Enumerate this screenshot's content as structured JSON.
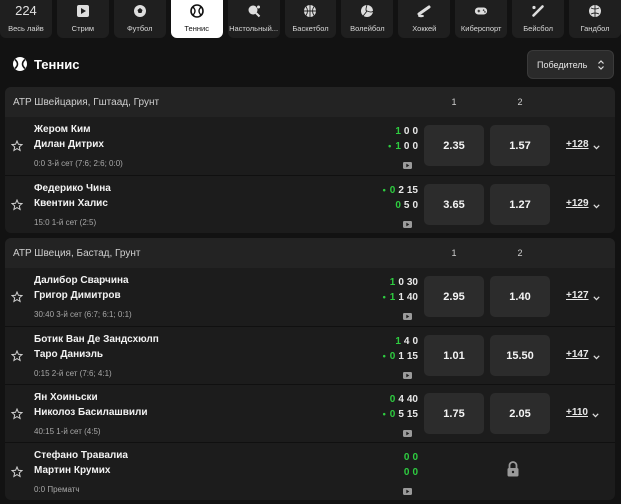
{
  "sports_bar": [
    {
      "label": "Весь лайв",
      "count": "224",
      "icon": "live-count",
      "active": false
    },
    {
      "label": "Стрим",
      "icon": "play-icon",
      "active": false
    },
    {
      "label": "Футбол",
      "icon": "soccer-ball-icon",
      "active": false
    },
    {
      "label": "Теннис",
      "icon": "tennis-ball-icon",
      "active": true
    },
    {
      "label": "Настольный...",
      "icon": "table-tennis-icon",
      "active": false
    },
    {
      "label": "Баскетбол",
      "icon": "basketball-icon",
      "active": false
    },
    {
      "label": "Волейбол",
      "icon": "volleyball-icon",
      "active": false
    },
    {
      "label": "Хоккей",
      "icon": "hockey-puck-icon",
      "active": false
    },
    {
      "label": "Киберспорт",
      "icon": "gamepad-icon",
      "active": false
    },
    {
      "label": "Бейсбол",
      "icon": "baseball-bat-icon",
      "active": false
    },
    {
      "label": "Гандбол",
      "icon": "handball-icon",
      "active": false
    }
  ],
  "page": {
    "title": "Теннис",
    "sort_label": "Победитель"
  },
  "colors": {
    "background": "#121212",
    "card": "#1c1c1c",
    "odd_button": "#2c2c2c",
    "score_highlight": "#2ecc40",
    "active_tab": "#ffffff"
  },
  "leagues": [
    {
      "name": "ATP Швейцария, Гштаад, Грунт",
      "col1": "1",
      "col2": "2",
      "matches": [
        {
          "p1": "Жером Ким",
          "p2": "Дилан Дитрих",
          "s1": [
            {
              "v": "1",
              "g": true
            },
            {
              "v": "0",
              "g": false
            },
            {
              "v": "0",
              "g": false
            }
          ],
          "s2": [
            {
              "v": "1",
              "g": true
            },
            {
              "v": "0",
              "g": false
            },
            {
              "v": "0",
              "g": false
            }
          ],
          "serve": 2,
          "status": "0:0 3-й сет (7:6; 2:6; 0:0)",
          "odd1": "2.35",
          "odd2": "1.57",
          "more": "+128",
          "video": true,
          "locked": false
        },
        {
          "p1": "Федерико Чина",
          "p2": "Квентин Халис",
          "s1": [
            {
              "v": "0",
              "g": true
            },
            {
              "v": "2",
              "g": false
            },
            {
              "v": "15",
              "g": false
            }
          ],
          "s2": [
            {
              "v": "0",
              "g": true
            },
            {
              "v": "5",
              "g": false
            },
            {
              "v": "0",
              "g": false
            }
          ],
          "serve": 1,
          "status": "15:0 1-й сет (2:5)",
          "odd1": "3.65",
          "odd2": "1.27",
          "more": "+129",
          "video": true,
          "locked": false
        }
      ]
    },
    {
      "name": "ATP Швеция, Бастад, Грунт",
      "col1": "1",
      "col2": "2",
      "matches": [
        {
          "p1": "Далибор Сварчина",
          "p2": "Григор Димитров",
          "s1": [
            {
              "v": "1",
              "g": true
            },
            {
              "v": "0",
              "g": false
            },
            {
              "v": "30",
              "g": false
            }
          ],
          "s2": [
            {
              "v": "1",
              "g": true
            },
            {
              "v": "1",
              "g": false
            },
            {
              "v": "40",
              "g": false
            }
          ],
          "serve": 2,
          "status": "30:40 3-й сет (6:7; 6:1; 0:1)",
          "odd1": "2.95",
          "odd2": "1.40",
          "more": "+127",
          "video": true,
          "locked": false
        },
        {
          "p1": "Ботик Ван Де Зандсхюлп",
          "p2": "Таро Даниэль",
          "s1": [
            {
              "v": "1",
              "g": true
            },
            {
              "v": "4",
              "g": false
            },
            {
              "v": "0",
              "g": false
            }
          ],
          "s2": [
            {
              "v": "0",
              "g": true
            },
            {
              "v": "1",
              "g": false
            },
            {
              "v": "15",
              "g": false
            }
          ],
          "serve": 2,
          "status": "0:15 2-й сет (7:6; 4:1)",
          "odd1": "1.01",
          "odd2": "15.50",
          "more": "+147",
          "video": true,
          "locked": false
        },
        {
          "p1": "Ян Хоиньски",
          "p2": "Николоз Басилашвили",
          "s1": [
            {
              "v": "0",
              "g": true
            },
            {
              "v": "4",
              "g": false
            },
            {
              "v": "40",
              "g": false
            }
          ],
          "s2": [
            {
              "v": "0",
              "g": true
            },
            {
              "v": "5",
              "g": false
            },
            {
              "v": "15",
              "g": false
            }
          ],
          "serve": 2,
          "status": "40:15 1-й сет (4:5)",
          "odd1": "1.75",
          "odd2": "2.05",
          "more": "+110",
          "video": true,
          "locked": false
        },
        {
          "p1": "Стефано Травалиа",
          "p2": "Мартин Крумих",
          "s1": [
            {
              "v": "0",
              "g": true
            },
            {
              "v": "0",
              "g": true
            }
          ],
          "s2": [
            {
              "v": "0",
              "g": true
            },
            {
              "v": "0",
              "g": true
            }
          ],
          "serve": 0,
          "status": "0:0 Прематч",
          "odd1": "",
          "odd2": "",
          "more": "",
          "video": true,
          "locked": true
        }
      ]
    }
  ]
}
